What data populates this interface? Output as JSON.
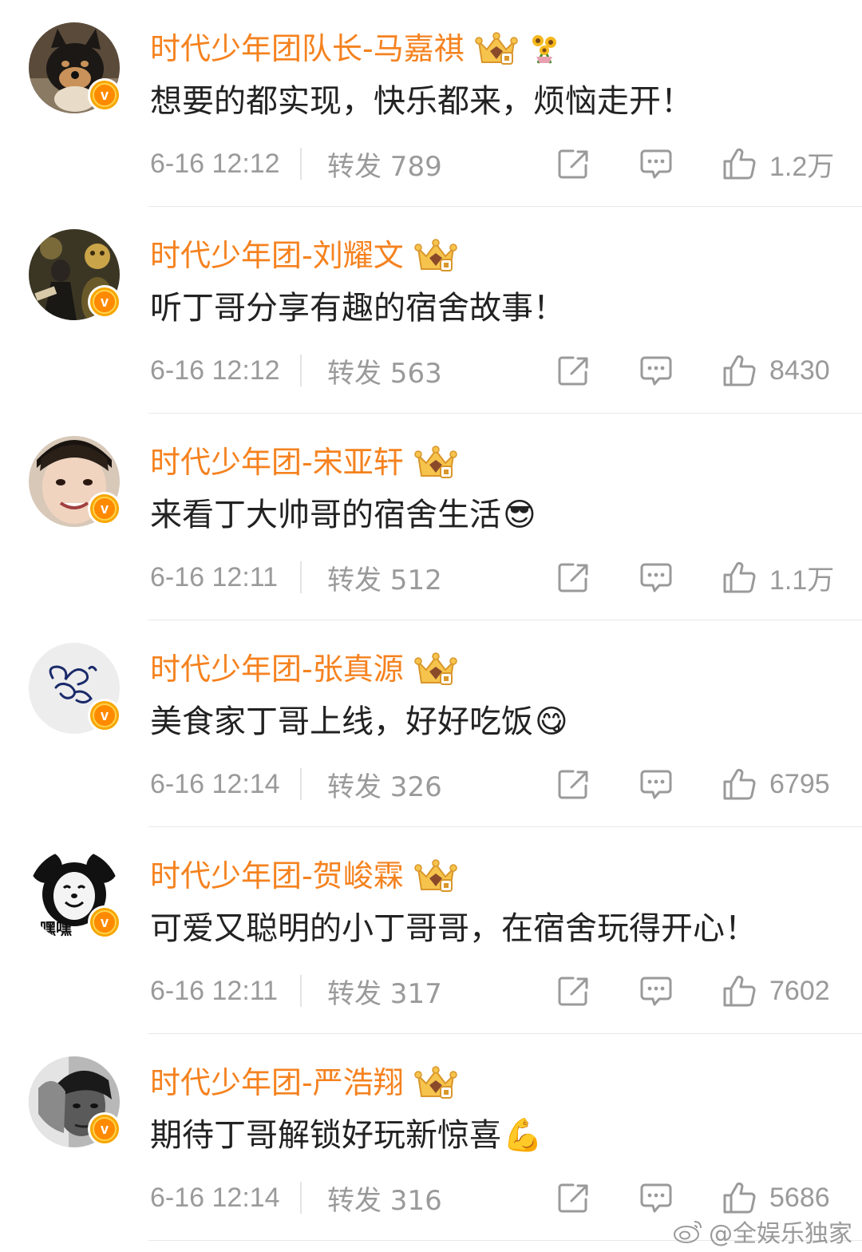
{
  "comments": [
    {
      "name": "时代少年团队长-马嘉祺",
      "text": "想要的都实现，快乐都来，烦恼走开！",
      "emoji": "",
      "time": "6-16 12:12",
      "repost": "转发 789",
      "likes": "1.2万",
      "avatar": "shiba-dog-avatar",
      "extra_icon": "sunflower-icon"
    },
    {
      "name": "时代少年团-刘耀文",
      "text": "听丁哥分享有趣的宿舍故事！",
      "emoji": "",
      "time": "6-16 12:12",
      "repost": "转发 563",
      "likes": "8430",
      "avatar": "dark-photo-avatar"
    },
    {
      "name": "时代少年团-宋亚轩",
      "text": "来看丁大帅哥的宿舍生活",
      "emoji": "😎",
      "time": "6-16 12:11",
      "repost": "转发 512",
      "likes": "1.1万",
      "avatar": "face-photo-avatar"
    },
    {
      "name": "时代少年团-张真源",
      "text": "美食家丁哥上线，好好吃饭",
      "emoji": "😋",
      "time": "6-16 12:14",
      "repost": "转发 326",
      "likes": "6795",
      "avatar": "signature-avatar"
    },
    {
      "name": "时代少年团-贺峻霖",
      "text": "可爱又聪明的小丁哥哥，在宿舍玩得开心！",
      "emoji": "",
      "time": "6-16 12:11",
      "repost": "转发 317",
      "likes": "7602",
      "avatar": "panda-meme-avatar",
      "avatar_text": "嘿嘿"
    },
    {
      "name": "时代少年团-严浩翔",
      "text": "期待丁哥解锁好玩新惊喜",
      "emoji": "💪",
      "time": "6-16 12:14",
      "repost": "转发 316",
      "likes": "5686",
      "avatar": "bw-photo-avatar"
    }
  ],
  "watermark": "@全娱乐独家",
  "colors": {
    "name": "#f5821f",
    "meta": "#9a9a9a",
    "text": "#222222",
    "badge": "#ff8a00"
  },
  "icons": {
    "verified": "v-badge-icon",
    "crown": "crown-icon",
    "share": "share-icon",
    "comment": "comment-icon",
    "like": "thumbs-up-icon"
  },
  "badge_letter": "v"
}
